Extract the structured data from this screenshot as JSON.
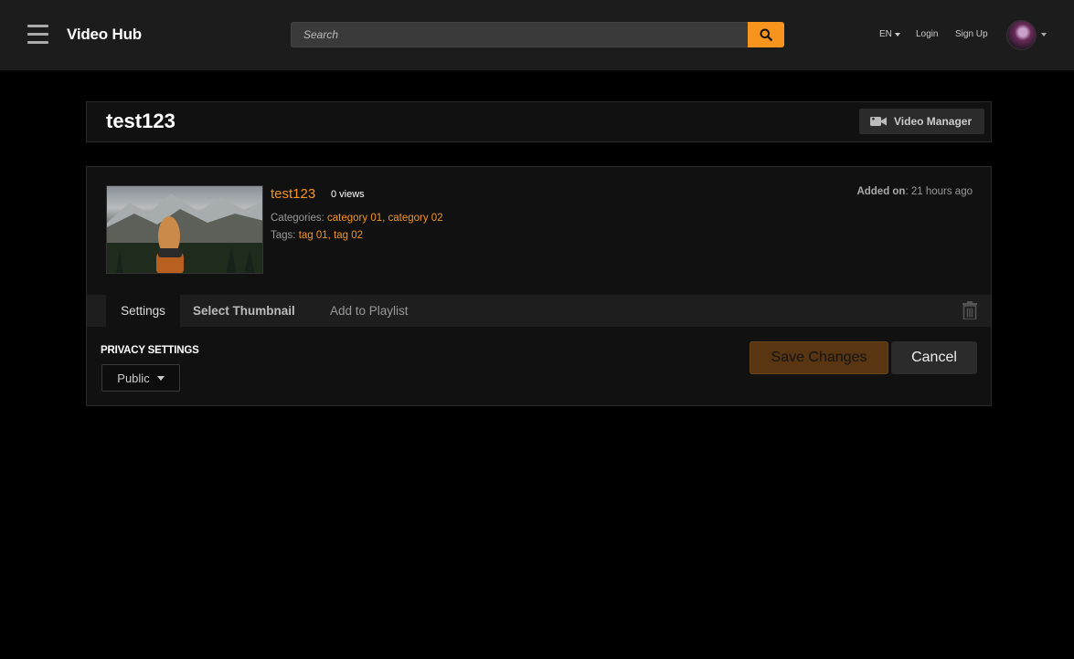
{
  "header": {
    "brand": "Video Hub",
    "search_placeholder": "Search",
    "language": "EN",
    "login": "Login",
    "signup": "Sign Up"
  },
  "title_bar": {
    "title": "test123",
    "video_manager_label": "Video Manager"
  },
  "video": {
    "title": "test123",
    "views": "0 views",
    "categories_label": "Categories:",
    "categories": "category 01, category 02",
    "tags_label": "Tags:",
    "tags": "tag 01, tag 02",
    "added_label": "Added on",
    "added_value": ": 21 hours ago"
  },
  "tabs": [
    {
      "label": "Settings",
      "active": true
    },
    {
      "label": "Select Thumbnail",
      "active": false
    },
    {
      "label": "Add to Playlist",
      "active": false
    }
  ],
  "settings": {
    "privacy_label": "PRIVACY SETTINGS",
    "privacy_value": "Public",
    "save_label": "Save Changes",
    "cancel_label": "Cancel"
  },
  "colors": {
    "accent": "#f7941d",
    "header_bg": "#1c1c1c",
    "panel_bg": "#111111"
  },
  "icons": [
    "menu-icon",
    "search-icon",
    "caret-down-icon",
    "avatar",
    "video-camera-icon",
    "trash-icon"
  ]
}
